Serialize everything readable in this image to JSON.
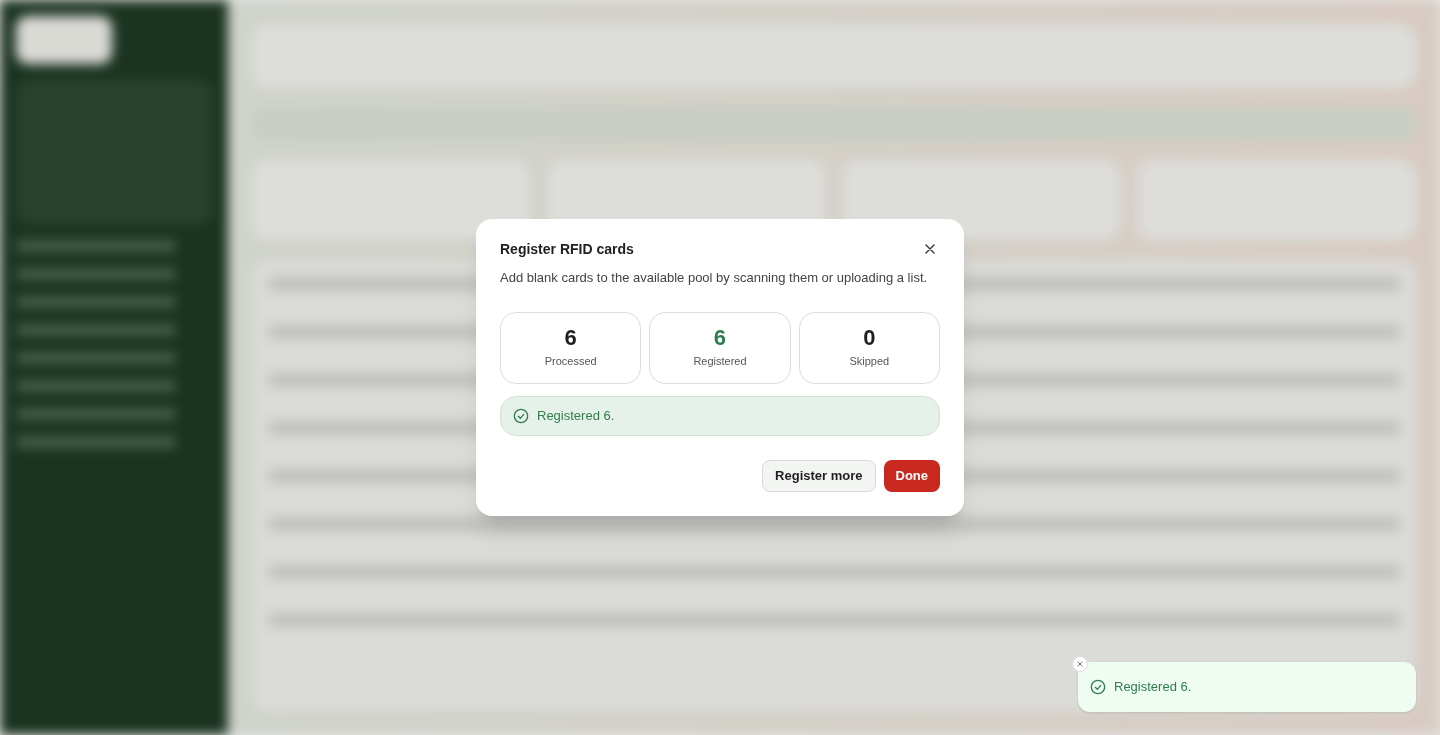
{
  "dialog": {
    "title": "Register RFID cards",
    "description": "Add blank cards to the available pool by scanning them or uploading a list.",
    "stats": [
      {
        "value": "6",
        "label": "Processed",
        "color": "#1f1f1f"
      },
      {
        "value": "6",
        "label": "Registered",
        "color": "#2f7d4f"
      },
      {
        "value": "0",
        "label": "Skipped",
        "color": "#1f1f1f"
      }
    ],
    "result": {
      "kind": "success",
      "message": "Registered 6."
    },
    "buttons": [
      {
        "label": "Register more",
        "kind": "secondary"
      },
      {
        "label": "Done",
        "kind": "primary"
      }
    ]
  },
  "toast": {
    "kind": "success",
    "message": "Registered 6."
  }
}
